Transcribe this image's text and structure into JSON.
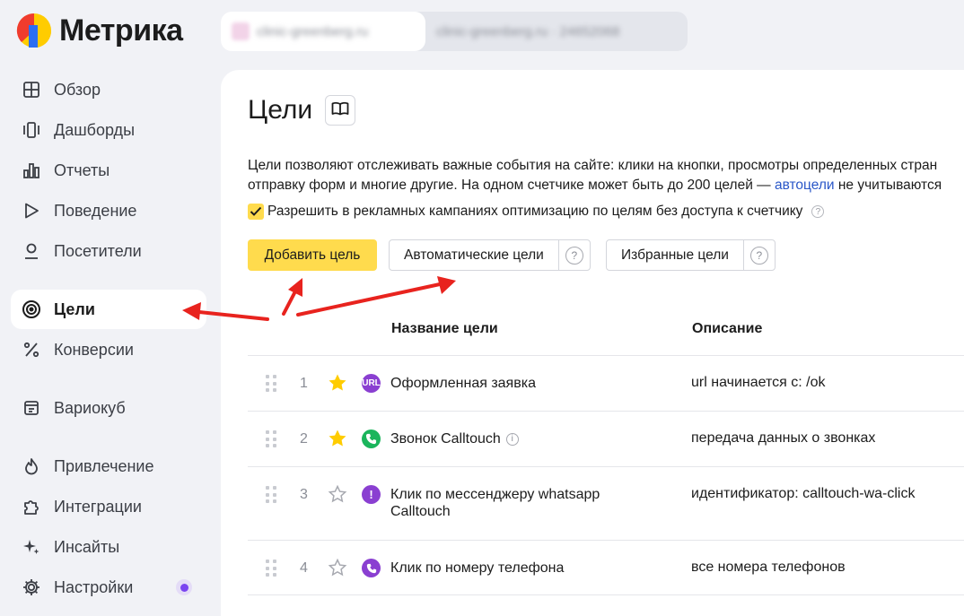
{
  "app": {
    "logo_text": "Метрика"
  },
  "header": {
    "counter_name": "clinic-greenberg.ru",
    "counter_meta": "clinic-greenberg.ru · 24652068"
  },
  "sidebar": {
    "items": [
      {
        "label": "Обзор",
        "icon": "grid-icon"
      },
      {
        "label": "Дашборды",
        "icon": "dashboards-icon"
      },
      {
        "label": "Отчеты",
        "icon": "bar-chart-icon"
      },
      {
        "label": "Поведение",
        "icon": "play-icon"
      },
      {
        "label": "Посетители",
        "icon": "user-icon"
      },
      {
        "label": "Цели",
        "icon": "target-icon",
        "active": true
      },
      {
        "label": "Конверсии",
        "icon": "percent-icon"
      },
      {
        "label": "Вариокуб",
        "icon": "variocube-icon"
      },
      {
        "label": "Привлечение",
        "icon": "fire-icon"
      },
      {
        "label": "Интеграции",
        "icon": "puzzle-icon"
      },
      {
        "label": "Инсайты",
        "icon": "sparkle-icon"
      },
      {
        "label": "Настройки",
        "icon": "gear-icon"
      }
    ]
  },
  "main": {
    "title": "Цели",
    "description_line1": "Цели позволяют отслеживать важные события на сайте: клики на кнопки, просмотры определенных стран",
    "description_line2_a": "отправку форм и многие другие. На одном счетчике может быть до 200 целей — ",
    "description_link": "автоцели",
    "description_line2_b": " не учитываются",
    "checkbox_label": "Разрешить в рекламных кампаниях оптимизацию по целям без доступа к счетчику",
    "add_button": "Добавить цель",
    "auto_goals_button": "Автоматические цели",
    "favorite_goals_button": "Избранные цели",
    "help_glyph": "?",
    "info_glyph": "i",
    "table": {
      "col_name": "Название цели",
      "col_desc": "Описание",
      "rows": [
        {
          "num": "1",
          "starred": true,
          "type": "url",
          "type_label": "URL",
          "type_color": "#8a3fd1",
          "name": "Оформленная заявка",
          "desc": "url начинается с: /ok"
        },
        {
          "num": "2",
          "starred": true,
          "type": "phone-call",
          "type_color": "#1bb55c",
          "name": "Звонок Calltouch",
          "has_info": true,
          "desc": "передача данных о звонках"
        },
        {
          "num": "3",
          "starred": false,
          "type": "event",
          "type_label": "!",
          "type_color": "#8a3fd1",
          "name": "Клик по мессенджеру whatsapp Calltouch",
          "desc": "идентификатор: calltouch-wa-click"
        },
        {
          "num": "4",
          "starred": false,
          "type": "phone",
          "type_color": "#8a3fd1",
          "name": "Клик по номеру телефона",
          "desc": "все номера телефонов"
        }
      ]
    }
  },
  "colors": {
    "accent_yellow": "#ffdb4d",
    "arrow_red": "#e8231e",
    "link_blue": "#2a57c8"
  }
}
